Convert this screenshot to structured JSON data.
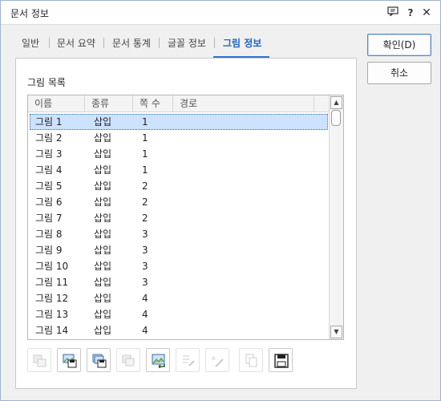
{
  "window": {
    "title": "문서 정보",
    "help_icon": "help-icon",
    "close_icon": "close-icon"
  },
  "tabs": [
    {
      "label": "일반"
    },
    {
      "label": "문서 요약"
    },
    {
      "label": "문서 통계"
    },
    {
      "label": "글꼴 정보"
    },
    {
      "label": "그림 정보",
      "active": true
    }
  ],
  "list": {
    "label": "그림 목록",
    "columns": [
      "이름",
      "종류",
      "쪽 수",
      "경로"
    ],
    "rows": [
      {
        "name": "그림 1",
        "type": "삽입",
        "page": "1",
        "path": ""
      },
      {
        "name": "그림 2",
        "type": "삽입",
        "page": "1",
        "path": ""
      },
      {
        "name": "그림 3",
        "type": "삽입",
        "page": "1",
        "path": ""
      },
      {
        "name": "그림 4",
        "type": "삽입",
        "page": "1",
        "path": ""
      },
      {
        "name": "그림 5",
        "type": "삽입",
        "page": "2",
        "path": ""
      },
      {
        "name": "그림 6",
        "type": "삽입",
        "page": "2",
        "path": ""
      },
      {
        "name": "그림 7",
        "type": "삽입",
        "page": "2",
        "path": ""
      },
      {
        "name": "그림 8",
        "type": "삽입",
        "page": "3",
        "path": ""
      },
      {
        "name": "그림 9",
        "type": "삽입",
        "page": "3",
        "path": ""
      },
      {
        "name": "그림 10",
        "type": "삽입",
        "page": "3",
        "path": ""
      },
      {
        "name": "그림 11",
        "type": "삽입",
        "page": "3",
        "path": ""
      },
      {
        "name": "그림 12",
        "type": "삽입",
        "page": "4",
        "path": ""
      },
      {
        "name": "그림 13",
        "type": "삽입",
        "page": "4",
        "path": ""
      },
      {
        "name": "그림 14",
        "type": "삽입",
        "page": "4",
        "path": ""
      }
    ],
    "selected_index": 0
  },
  "buttons": {
    "ok": "확인(D)",
    "cancel": "취소"
  },
  "toolbar": [
    {
      "icon": "image-extract-icon",
      "enabled": false
    },
    {
      "icon": "image-save-icon",
      "enabled": true
    },
    {
      "icon": "images-save-all-icon",
      "enabled": true
    },
    {
      "icon": "image-copy-icon",
      "enabled": false
    },
    {
      "icon": "image-goto-icon",
      "enabled": true
    },
    {
      "icon": "image-properties-icon",
      "enabled": false
    },
    {
      "icon": "image-rename-icon",
      "enabled": false
    },
    {
      "icon": "copy-icon",
      "enabled": false
    },
    {
      "icon": "save-icon",
      "enabled": true
    }
  ],
  "colors": {
    "accent": "#2f74d0",
    "selection": "#cde2ff"
  }
}
